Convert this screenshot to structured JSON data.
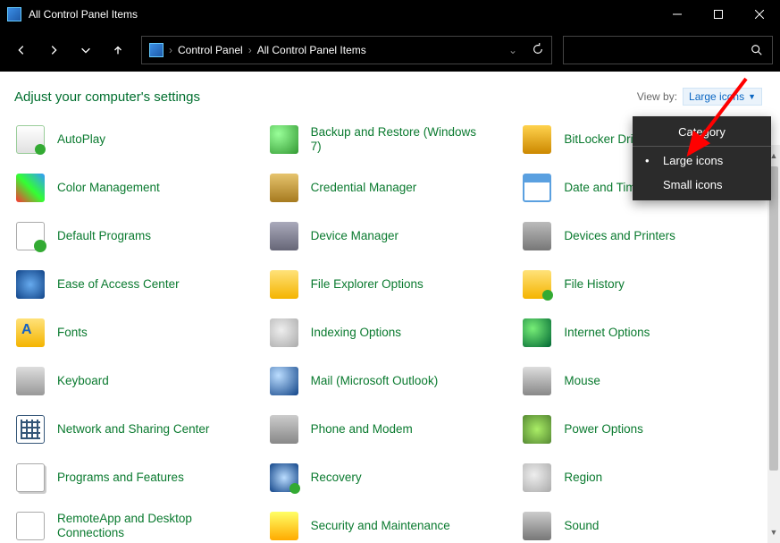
{
  "window": {
    "title": "All Control Panel Items"
  },
  "breadcrumb": {
    "root": "Control Panel",
    "current": "All Control Panel Items"
  },
  "header": {
    "title": "Adjust your computer's settings",
    "viewby_label": "View by:",
    "viewby_value": "Large icons"
  },
  "viewmenu": {
    "category": "Category",
    "large": "Large icons",
    "small": "Small icons"
  },
  "items": [
    {
      "label": "AutoPlay",
      "ic": "ic-autoplay",
      "name": "autoplay"
    },
    {
      "label": "Backup and Restore (Windows 7)",
      "ic": "ic-backup",
      "name": "backup-restore"
    },
    {
      "label": "BitLocker Drive Encryption",
      "ic": "ic-bitlocker",
      "name": "bitlocker"
    },
    {
      "label": "Color Management",
      "ic": "ic-color",
      "name": "color-management"
    },
    {
      "label": "Credential Manager",
      "ic": "ic-cred",
      "name": "credential-manager"
    },
    {
      "label": "Date and Time",
      "ic": "ic-date",
      "name": "date-time"
    },
    {
      "label": "Default Programs",
      "ic": "ic-default",
      "name": "default-programs"
    },
    {
      "label": "Device Manager",
      "ic": "ic-device",
      "name": "device-manager"
    },
    {
      "label": "Devices and Printers",
      "ic": "ic-devprint",
      "name": "devices-printers"
    },
    {
      "label": "Ease of Access Center",
      "ic": "ic-ease",
      "name": "ease-of-access"
    },
    {
      "label": "File Explorer Options",
      "ic": "ic-explorer",
      "name": "file-explorer-options"
    },
    {
      "label": "File History",
      "ic": "ic-filehist",
      "name": "file-history"
    },
    {
      "label": "Fonts",
      "ic": "ic-fonts",
      "name": "fonts"
    },
    {
      "label": "Indexing Options",
      "ic": "ic-index",
      "name": "indexing-options"
    },
    {
      "label": "Internet Options",
      "ic": "ic-inet",
      "name": "internet-options"
    },
    {
      "label": "Keyboard",
      "ic": "ic-kbd",
      "name": "keyboard"
    },
    {
      "label": "Mail (Microsoft Outlook)",
      "ic": "ic-mail",
      "name": "mail"
    },
    {
      "label": "Mouse",
      "ic": "ic-mouse",
      "name": "mouse"
    },
    {
      "label": "Network and Sharing Center",
      "ic": "ic-net",
      "name": "network-sharing"
    },
    {
      "label": "Phone and Modem",
      "ic": "ic-phone",
      "name": "phone-modem"
    },
    {
      "label": "Power Options",
      "ic": "ic-power",
      "name": "power-options"
    },
    {
      "label": "Programs and Features",
      "ic": "ic-prog",
      "name": "programs-features"
    },
    {
      "label": "Recovery",
      "ic": "ic-recov",
      "name": "recovery"
    },
    {
      "label": "Region",
      "ic": "ic-region",
      "name": "region"
    },
    {
      "label": "RemoteApp and Desktop Connections",
      "ic": "ic-remote",
      "name": "remoteapp"
    },
    {
      "label": "Security and Maintenance",
      "ic": "ic-sec",
      "name": "security-maintenance"
    },
    {
      "label": "Sound",
      "ic": "ic-sound",
      "name": "sound"
    }
  ]
}
